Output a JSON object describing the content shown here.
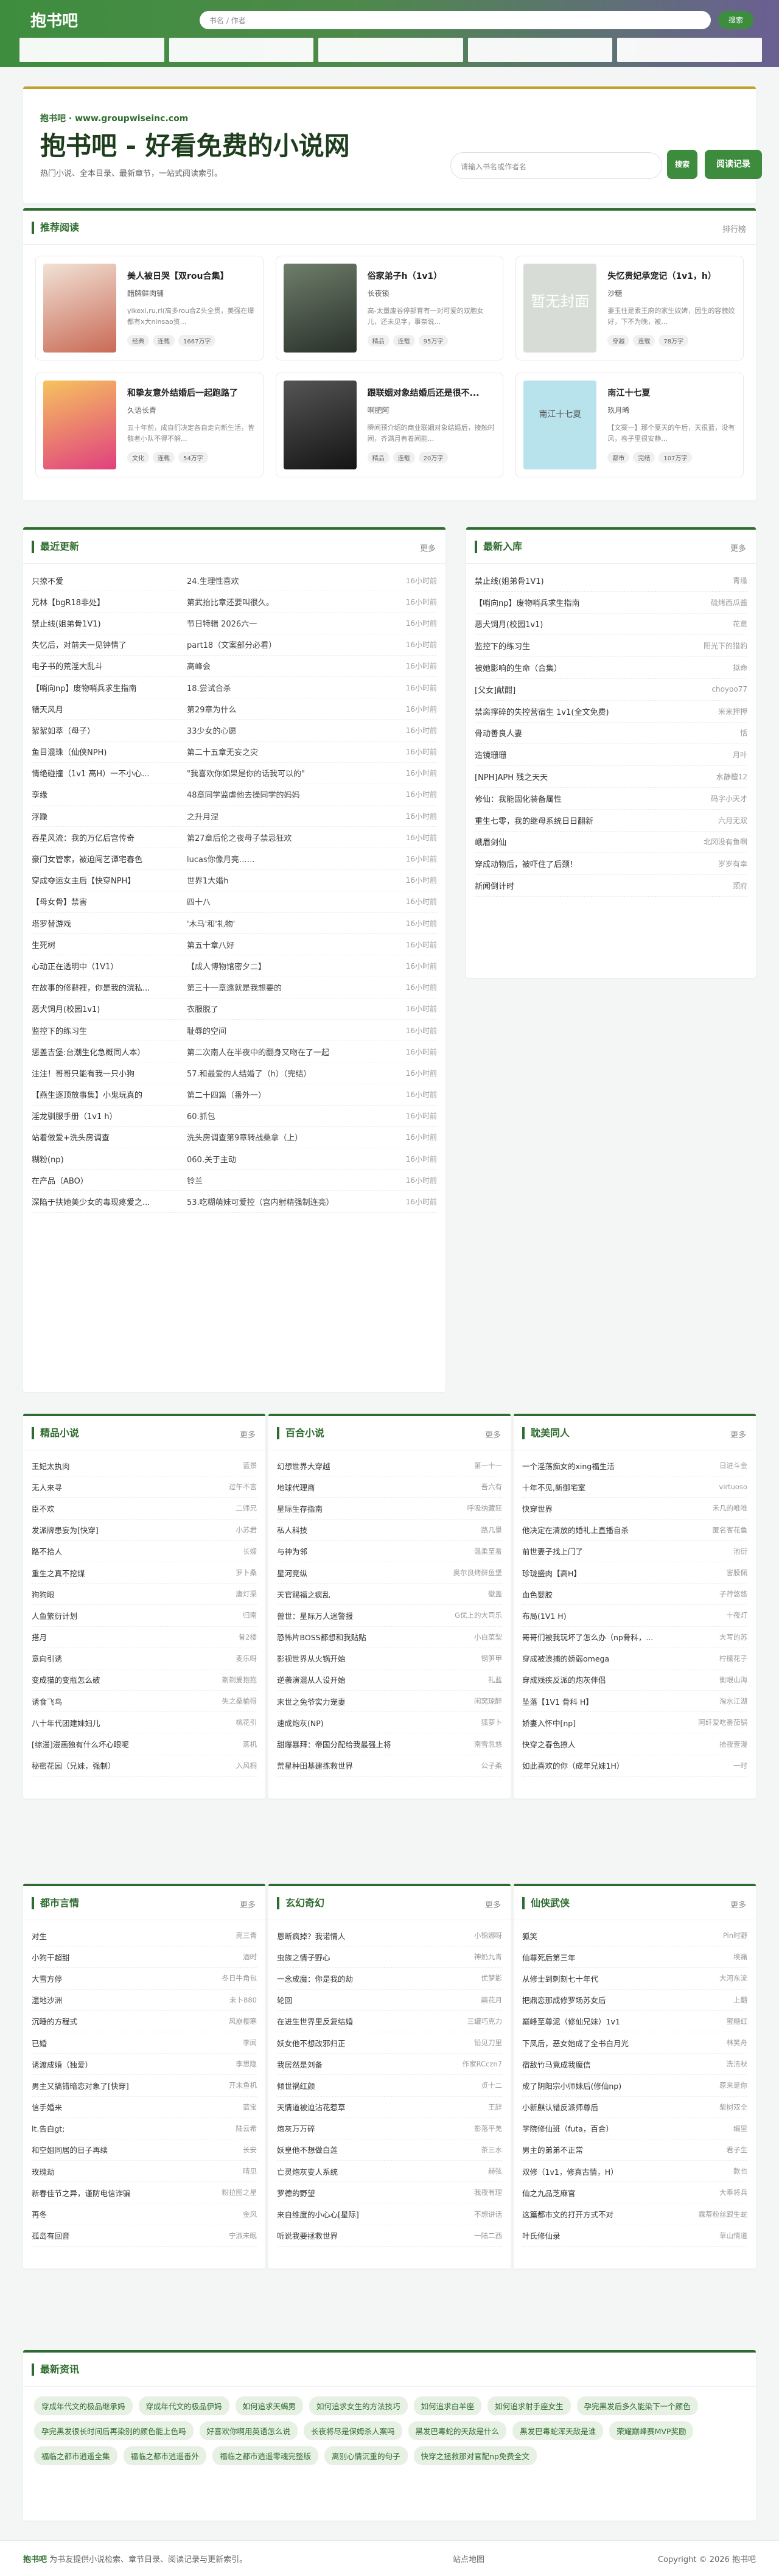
{
  "header": {
    "logo": "抱书吧",
    "search_placeholder": "书名 / 作者",
    "search_btn": "搜索"
  },
  "hero": {
    "site": "抱书吧 · www.groupwiseinc.com",
    "title": "抱书吧 - 好看免费的小说网",
    "desc": "热门小说、全本目录、最新章节，一站式阅读索引。",
    "search_placeholder": "请输入书名或作者名",
    "search_btn": "搜索",
    "history_btn": "阅读记录"
  },
  "recommend": {
    "title": "推荐阅读",
    "more": "排行榜",
    "cards": [
      {
        "title": "美人被日哭【双rou合集】",
        "author": "醋牌鲜肉铺",
        "desc": "yikexi,ru,rl(高多rou合Z头全贯，美强在爆都有x大ninsao资...",
        "tags": [
          "经典",
          "连载",
          "1667万字"
        ],
        "cover": ""
      },
      {
        "title": "俗家弟子h（1v1）",
        "author": "长夜锁",
        "desc": "高-太量废谷停部育有一对可爱的双胞女儿，还未见字，事奈说...",
        "tags": [
          "精品",
          "连载",
          "95万字"
        ],
        "cover": ""
      },
      {
        "title": "失忆贵妃承宠记（1v1，h）",
        "author": "沙糖",
        "desc": "妻玉住是素王府的家生奴婢，因生的容貌姣好，下不为晚，被...",
        "tags": [
          "穿越",
          "连载",
          "78万字"
        ],
        "cover": "暂无封面"
      },
      {
        "title": "和挚友意外结婚后一起跑路了",
        "author": "久语长青",
        "desc": "五十年前，成自们决定各自走向新生活，皆骸者小队不得不解...",
        "tags": [
          "文化",
          "连载",
          "54万字"
        ],
        "cover": ""
      },
      {
        "title": "跟联姻对象结婚后还是很不...",
        "author": "啊肥阿",
        "desc": "瞬间预介绍的商业联姻对象结婚后，接触时间，齐满月有着间能...",
        "tags": [
          "精品",
          "连载",
          "20万字"
        ],
        "cover": ""
      },
      {
        "title": "南江十七夏",
        "author": "玖月晞",
        "desc": "【文案一】那个夏天的午后，天很蓝，没有风，卷子里很安静...",
        "tags": [
          "都市",
          "完结",
          "107万字"
        ],
        "cover": "南江十七夏"
      }
    ]
  },
  "latest": {
    "title": "最近更新",
    "more": "更多",
    "rows": [
      [
        "只撩不爱",
        "24.生理性喜欢",
        "16小时前"
      ],
      [
        "兄林【bgR18非处】",
        "第武抬比章还要叫很久。",
        "16小时前"
      ],
      [
        "禁止线(姐弟骨1V1)",
        "节日特辑 2026六一",
        "16小时前"
      ],
      [
        "失忆后，对前夫一见钟情了",
        "part18（文案部分必看）",
        "16小时前"
      ],
      [
        "电子书的荒淫大乱斗",
        "高峰会",
        "16小时前"
      ],
      [
        "【哨向np】废物哨兵求生指南",
        "18.尝试合杀",
        "16小时前"
      ],
      [
        "错天风月",
        "第29章为什么",
        "16小时前"
      ],
      [
        "絮絮如萃（母子）",
        "33少女的心愿",
        "16小时前"
      ],
      [
        "鱼目混珠（仙侠NPH)",
        "第二十五章无妄之灾",
        "16小时前"
      ],
      [
        "情绝碰撞（1v1 高H）一不小心...",
        "\"我喜欢你如果是你的话我可以的\"",
        "16小时前"
      ],
      [
        "孪缘",
        "48章同学监虐他去操同学的妈妈",
        "16小时前"
      ],
      [
        "浮躁",
        "之升月涅",
        "16小时前"
      ],
      [
        "吞星风流：我的万亿后宫传奇",
        "第27章后伦之夜母子禁忌狂欢",
        "16小时前"
      ],
      [
        "豪门女管家，被迫闯艺谭宅春色",
        "lucas你像月亮……",
        "16小时前"
      ],
      [
        "穿成夺运女主后【快穿NPH】",
        "世界1大婚h",
        "16小时前"
      ],
      [
        "【母女骨】禁害",
        "四十八",
        "16小时前"
      ],
      [
        "塔罗替游戏",
        "'木马'和'礼物'",
        "16小时前"
      ],
      [
        "生死树",
        "第五十章八好",
        "16小时前"
      ],
      [
        "心动正在透明中（1V1）",
        "【成人博物馆密夕二】",
        "16小时前"
      ],
      [
        "在故事的修辭裡，你是我的浣私...",
        "第三十一章遠就是我想要的",
        "16小时前"
      ],
      [
        "恶犬饲月(校园1v1)",
        "衣服脱了",
        "16小时前"
      ],
      [
        "监控下的练习生",
        "耻辱的空间",
        "16小时前"
      ],
      [
        "惩盖吉堡:台潮生化急概同人本）",
        "第二次南人在半夜中的翻身又吻在了一起",
        "16小时前"
      ],
      [
        "注注！哥哥只能有我一只小狗",
        "57.和最爱的人结婚了（h）（完结）",
        "16小时前"
      ],
      [
        "【燕生逐顶放事集】小鬼玩真的",
        "第二十四篇（番外一）",
        "16小时前"
      ],
      [
        "淫龙驯服手册（1v1 h）",
        "60.抓包",
        "16小时前"
      ],
      [
        "站着做爱+洗头房调查",
        "洗头房调查第9章转战桑拿（上）",
        "16小时前"
      ],
      [
        "糊粉(np)",
        "060.关于主动",
        "16小时前"
      ],
      [
        "在产品（ABO）",
        "铃兰",
        "16小时前"
      ],
      [
        "深陷于扶她美少女的毒现疼爱之...",
        "53.吃糊萌妹可爱控（宫内射精强制连亮）",
        "16小时前"
      ]
    ]
  },
  "newest": {
    "title": "最新入库",
    "more": "更多",
    "rows": [
      [
        "禁止线(姐弟骨1V1)",
        "青缘"
      ],
      [
        "【哨向np】废物哨兵求生指南",
        "硫烤西瓜酱"
      ],
      [
        "恶犬饲月(校园1v1)",
        "花意"
      ],
      [
        "监控下的练习生",
        "阳光下的猎豹"
      ],
      [
        "被她影响的生命（合集）",
        "拟命"
      ],
      [
        "[父女]献酣]",
        "choyoo77"
      ],
      [
        "禁脔撑碎的失控营宿生 1v1(全文免费)",
        "米米押押"
      ],
      [
        "骨动善良人妻",
        "恬"
      ],
      [
        "造镜珊珊",
        "月叶"
      ],
      [
        "[NPH]APH 残之天天",
        "水静檀12"
      ],
      [
        "修仙：我能固化装备属性",
        "码字小天才"
      ],
      [
        "重生七零，我的继母系统日日翻新",
        "六月无双"
      ],
      [
        "峨眉剑仙",
        "北冈没有鱼啊"
      ],
      [
        "穿成动物后，被吓住了后颈！",
        "岁岁有幸"
      ],
      [
        "新闻倒计时",
        "颈府"
      ]
    ]
  },
  "sections": [
    {
      "title": "精品小说",
      "more": "更多",
      "rows": [
        [
          "王妃太执肉",
          "蓝景"
        ],
        [
          "无人来寻",
          "过午不言"
        ],
        [
          "臣不欢",
          "二师兄"
        ],
        [
          "发派牌患妄为[快穿]",
          "小苏君"
        ],
        [
          "路不拾人",
          "长嫂"
        ],
        [
          "重生之真不挖煤",
          "罗卜桑"
        ],
        [
          "狗狗眼",
          "唐灯渠"
        ],
        [
          "人鱼繁衍计划",
          "归南"
        ],
        [
          "搭月",
          "昔2楼"
        ],
        [
          "意向引诱",
          "麦乐呀"
        ],
        [
          "变成猫的变瓶怎么破",
          "剃剃爱抱抱"
        ],
        [
          "诱食飞鸟",
          "失之桑榆得"
        ],
        [
          "八十年代团建妹妇儿",
          "桃花引"
        ],
        [
          "[综漫]漫画独有什么坏心眼呢",
          "蒸机"
        ],
        [
          "秘密花园（兄妹，强制）",
          "入风桐"
        ]
      ]
    },
    {
      "title": "百合小说",
      "more": "更多",
      "rows": [
        [
          "幻想世界大穿越",
          "第一十一"
        ],
        [
          "地球代理商",
          "吾六有"
        ],
        [
          "星际生存指南",
          "呼吸纳藏狂"
        ],
        [
          "私人科技",
          "路几景"
        ],
        [
          "与神为邻",
          "温柔至羞"
        ],
        [
          "星河竞纵",
          "奥尔良烤鲜鱼堡"
        ],
        [
          "天官赐福之疯乱",
          "徽盖"
        ],
        [
          "兽世：星际万人迷警报",
          "G优上的大司乐"
        ],
        [
          "恐怖片BOSS都想和我贴贴",
          "小白菜梨"
        ],
        [
          "影视世界从火锅开始",
          "钢笋甲"
        ],
        [
          "逆袭演混从人设开始",
          "礼蓝"
        ],
        [
          "末世之兔爷实力宠妻",
          "闲窝琼醉"
        ],
        [
          "速成炮灰(NP)",
          "狐萝卜"
        ],
        [
          "甜爆暴拜：帝国分配给我最强上将",
          "南雪忽悠"
        ],
        [
          "荒星种田基建拣救世界",
          "公子柔"
        ]
      ]
    },
    {
      "title": "耽美同人",
      "more": "更多",
      "rows": [
        [
          "一个淫荡痴女的xing福生活",
          "日进斗金"
        ],
        [
          "十年不见,新御宅室",
          "virtuoso"
        ],
        [
          "快穿世界",
          "禾几的唯唯"
        ],
        [
          "他决定在清放的婚礼上直播自杀",
          "匿名客花鱼"
        ],
        [
          "前世妻子找上门了",
          "池衍"
        ],
        [
          "珍珑盛肉【高H】",
          "害膜佩"
        ],
        [
          "血色婴胶",
          "子荇悠悠"
        ],
        [
          "布局(1V1 H)",
          "十夜灯"
        ],
        [
          "哥哥们被我玩坏了怎么办（np骨科，...",
          "大写的苏"
        ],
        [
          "穿成被浪捕的娇弱omega",
          "柠檬花子"
        ],
        [
          "穿成残疾反派的炮灰伴侣",
          "衡眼山海"
        ],
        [
          "坠落【1V1 骨科 H】",
          "淘水江湖"
        ],
        [
          "娇妻入怀中[np]",
          "阿纤爱吃番茄锅"
        ],
        [
          "快穿之春色撩人",
          "拾夜壹漫"
        ],
        [
          "如此喜欢的你（成年兄妹1H）",
          "一时"
        ]
      ]
    },
    {
      "title": "都市言情",
      "more": "更多",
      "rows": [
        [
          "对生",
          "亮三青"
        ],
        [
          "小狗干超甜",
          "酒时"
        ],
        [
          "大雪方停",
          "冬日牛角包"
        ],
        [
          "湿地沙洲",
          "未卜880"
        ],
        [
          "沉睡的方程式",
          "风崩樱寒"
        ],
        [
          "已婚",
          "李闻"
        ],
        [
          "诱渡成婚（独爱）",
          "李思隐"
        ],
        [
          "男主又搞错暗恋对象了[快穿]",
          "开末鱼机"
        ],
        [
          "信手婚来",
          "蓝宝"
        ],
        [
          "lt.告白gt;",
          "陆云希"
        ],
        [
          "和空姐同居的日子再续",
          "长安"
        ],
        [
          "玫瑰劫",
          "晴见"
        ],
        [
          "新春佳节之异，谨防电信诈骗",
          "粉拉图之星"
        ],
        [
          "再冬",
          "金风"
        ],
        [
          "孤岛有回音",
          "宁淑未眠"
        ]
      ]
    },
    {
      "title": "玄幻奇幻",
      "more": "更多",
      "rows": [
        [
          "恩断疯掉？我诺情人",
          "小锦娜呀"
        ],
        [
          "虫族之情子野心",
          "神奶九青"
        ],
        [
          "一念成魔：你是我的劫",
          "优梦影"
        ],
        [
          "轮回",
          "鹃花月"
        ],
        [
          "在进生世界里反复结婚",
          "三罐巧克力"
        ],
        [
          "妖女他不想改邪归正",
          "铅见刀里"
        ],
        [
          "我居然是刘备",
          "作家RCczn7"
        ],
        [
          "倾世祸红颜",
          "贞十二"
        ],
        [
          "天情道被迫沾花惹草",
          "王辞"
        ],
        [
          "炮灰万万碎",
          "影落平羌"
        ],
        [
          "妖皇他不想做白莲",
          "茶三水"
        ],
        [
          "亡灵炮灰变人系统",
          "赫弦"
        ],
        [
          "罗德的野望",
          "我夜有理"
        ],
        [
          "来自维度的小心心[星际]",
          "不想讲话"
        ],
        [
          "听说我要拯救世界",
          "一陆二西"
        ]
      ]
    },
    {
      "title": "仙侠武侠",
      "more": "更多",
      "rows": [
        [
          "狐笑",
          "Pin时野"
        ],
        [
          "仙尊死后第三年",
          "埃痛"
        ],
        [
          "从修士到刺刻七十年代",
          "大河东流"
        ],
        [
          "把鼎恋那成修罗场苏女后",
          "上翻"
        ],
        [
          "巅峰至尊泥（修仙兄妹）1v1",
          "蜜糖红"
        ],
        [
          "下凤后，恶女她成了全书白月光",
          "林笑舟"
        ],
        [
          "宿敌竹马竟成我魔信",
          "洗清秋"
        ],
        [
          "成了阴阳宗小师妹后(修仙np)",
          "原来是你"
        ],
        [
          "小新麒认错反派师尊后",
          "柴树双全"
        ],
        [
          "学院修仙班（futa，百合）",
          "编里"
        ],
        [
          "男主的弟弟不正常",
          "君子生"
        ],
        [
          "双修（1v1，修真古情，H）",
          "款也"
        ],
        [
          "仙之九品芝麻官",
          "大奉将兵"
        ],
        [
          "这篇都市文的打开方式不对",
          "霖蒂粉丝跟生蛇"
        ],
        [
          "叶氏修仙录",
          "草山情道"
        ]
      ]
    }
  ],
  "news": {
    "title": "最新资讯",
    "chips": [
      "穿成年代文的极品继承妈",
      "穿成年代文的极品伊妈",
      "如何追求天蝎男",
      "如何追求女生的方法技巧",
      "如何追求白羊座",
      "如何追求射手座女生",
      "孕完黑发后多久能染下一个颜色",
      "孕完黑发很长时间后再染别的颜色能上色吗",
      "好喜欢你啊用英语怎么说",
      "长夜将尽是保姆杀人案吗",
      "黑发巴毒蛇的天敌是什么",
      "黑发巴毒蛇浑天敌是谁",
      "荣耀巅峰赛MVP奖励",
      "福临之都市逍遥全集",
      "福临之都市逍遥番外",
      "福临之都市逍遥零魂完整版",
      "离别心情沉重的句子",
      "快穿之拯救那对官配np免费全文"
    ]
  },
  "footer": {
    "site": "抱书吧",
    "text": "为书友提供小说检索、章节目录、阅读记录与更新索引。",
    "map": "站点地图",
    "copyright": "Copyright © 2026 抱书吧"
  }
}
